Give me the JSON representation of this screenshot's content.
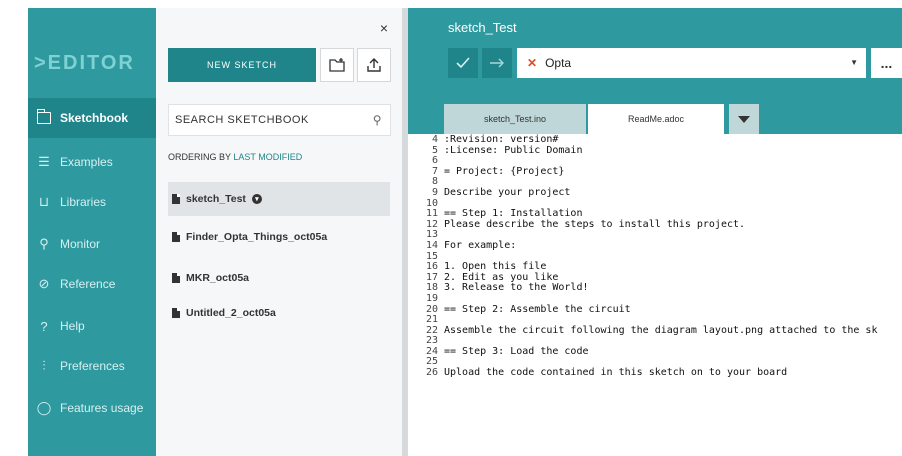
{
  "sidebar": {
    "logo": ">EDITOR",
    "items": [
      {
        "label": "Sketchbook",
        "icon": "sketchbook-icon"
      },
      {
        "label": "Examples",
        "icon": "examples-icon"
      },
      {
        "label": "Libraries",
        "icon": "libraries-icon"
      },
      {
        "label": "Monitor",
        "icon": "monitor-icon"
      },
      {
        "label": "Reference",
        "icon": "reference-icon"
      },
      {
        "label": "Help",
        "icon": "help-icon"
      },
      {
        "label": "Preferences",
        "icon": "preferences-icon"
      },
      {
        "label": "Features usage",
        "icon": "features-usage-icon"
      }
    ]
  },
  "panel": {
    "close": "×",
    "new_sketch": "NEW SKETCH",
    "search_placeholder": "SEARCH SKETCHBOOK",
    "ordering_prefix": "ORDERING BY",
    "ordering_value": "LAST MODIFIED",
    "sketches": [
      "sketch_Test",
      "Finder_Opta_Things_oct05a",
      "MKR_oct05a",
      "Untitled_2_oct05a"
    ]
  },
  "editor": {
    "title": "sketch_Test",
    "board": "Opta",
    "more": "...",
    "tabs": [
      "sketch_Test.ino",
      "ReadMe.adoc"
    ],
    "lines": [
      {
        "n": "4",
        "text": ":Revision: version#"
      },
      {
        "n": "5",
        "text": ":License: Public Domain"
      },
      {
        "n": "6",
        "text": ""
      },
      {
        "n": "7",
        "text": "= Project: {Project}"
      },
      {
        "n": "8",
        "text": ""
      },
      {
        "n": "9",
        "text": "Describe your project"
      },
      {
        "n": "10",
        "text": ""
      },
      {
        "n": "11",
        "text": "== Step 1: Installation"
      },
      {
        "n": "12",
        "text": "Please describe the steps to install this project."
      },
      {
        "n": "13",
        "text": ""
      },
      {
        "n": "14",
        "text": "For example:"
      },
      {
        "n": "15",
        "text": ""
      },
      {
        "n": "16",
        "text": "1. Open this file"
      },
      {
        "n": "17",
        "text": "2. Edit as you like"
      },
      {
        "n": "18",
        "text": "3. Release to the World!"
      },
      {
        "n": "19",
        "text": ""
      },
      {
        "n": "20",
        "text": "== Step 2: Assemble the circuit"
      },
      {
        "n": "21",
        "text": ""
      },
      {
        "n": "22",
        "text": "Assemble the circuit following the diagram layout.png attached to the sk"
      },
      {
        "n": "23",
        "text": ""
      },
      {
        "n": "24",
        "text": "== Step 3: Load the code"
      },
      {
        "n": "25",
        "text": ""
      },
      {
        "n": "26",
        "text": "Upload the code contained in this sketch on to your board"
      }
    ]
  }
}
